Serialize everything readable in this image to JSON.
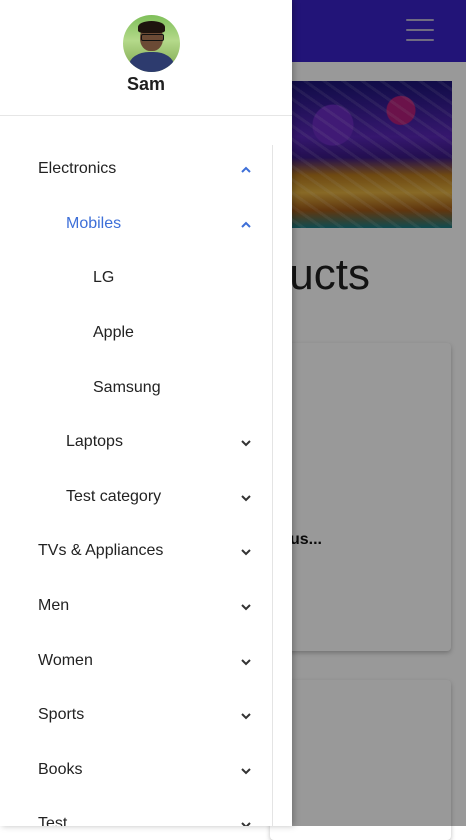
{
  "background": {
    "heading": "ucts",
    "card_title": "us..."
  },
  "drawer": {
    "user": {
      "name": "Sam"
    },
    "nav": {
      "electronics": "Electronics",
      "mobiles": "Mobiles",
      "lg": "LG",
      "apple": "Apple",
      "samsung": "Samsung",
      "laptops": "Laptops",
      "test_category": "Test category",
      "tvs": "TVs & Appliances",
      "men": "Men",
      "women": "Women",
      "sports": "Sports",
      "books": "Books",
      "test": "Test"
    }
  },
  "colors": {
    "app_bar": "#3a22c8",
    "active_nav": "#3d6fd8",
    "scrim": "rgba(0,0,0,0.40)"
  },
  "icons": {
    "menu": "menu-icon",
    "expanded": "chevron-up-icon",
    "collapsed": "chevron-down-icon"
  }
}
